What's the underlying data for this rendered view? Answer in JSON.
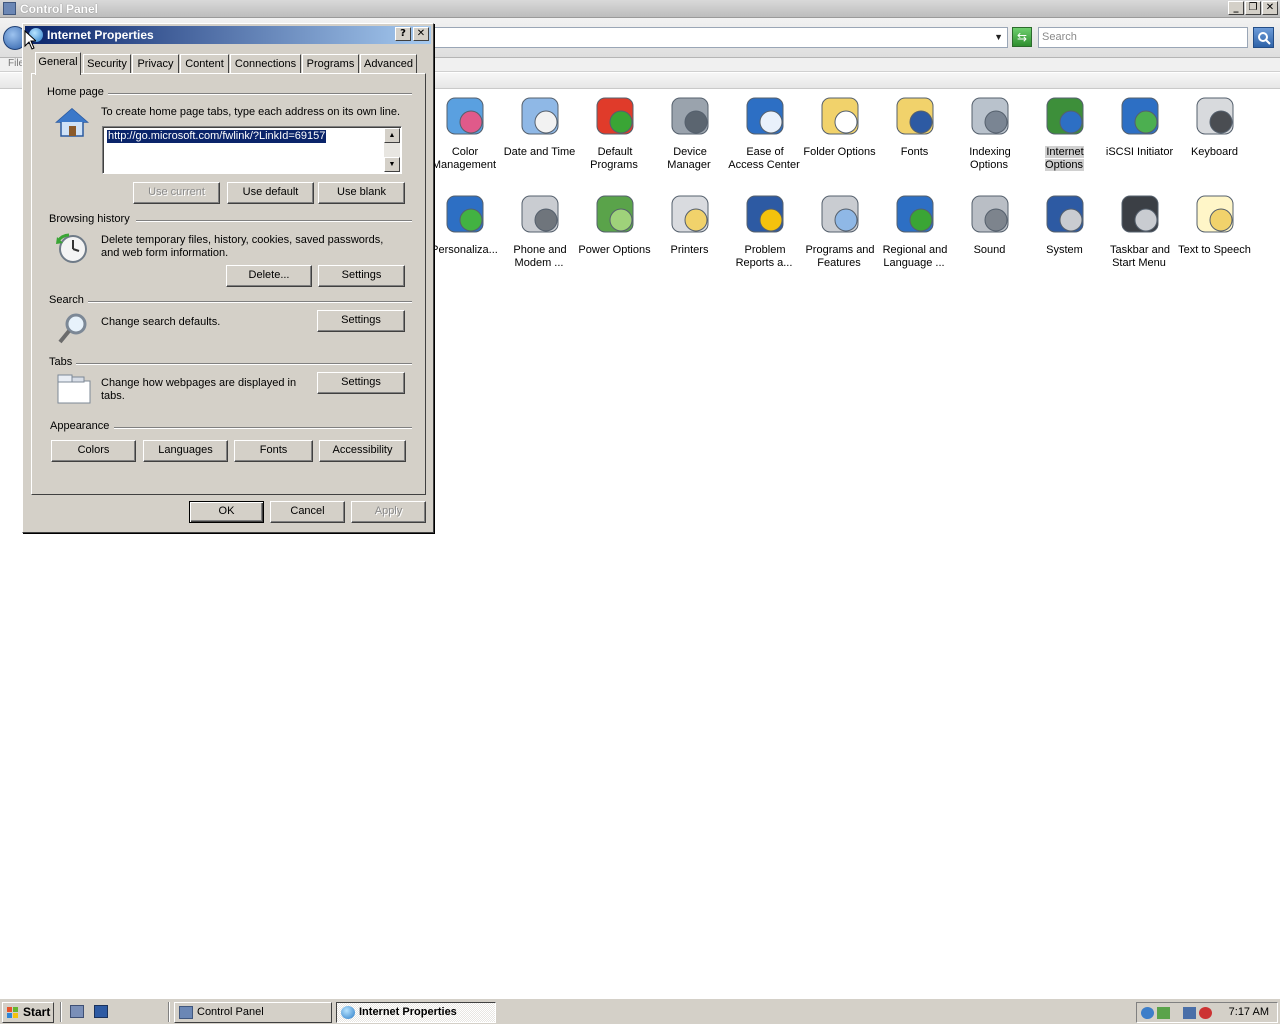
{
  "main_window": {
    "title": "Control Panel",
    "search_placeholder": "Search",
    "menu_partial": "File",
    "controls": {
      "minimize": "_",
      "maximize": "❐",
      "close": "✕"
    }
  },
  "control_panel_items": [
    {
      "label": "Color Management",
      "icon": "color-management-icon"
    },
    {
      "label": "Date and Time",
      "icon": "date-time-icon"
    },
    {
      "label": "Default Programs",
      "icon": "default-programs-icon"
    },
    {
      "label": "Device Manager",
      "icon": "device-manager-icon"
    },
    {
      "label": "Ease of Access Center",
      "icon": "ease-of-access-icon"
    },
    {
      "label": "Folder Options",
      "icon": "folder-options-icon"
    },
    {
      "label": "Fonts",
      "icon": "fonts-icon"
    },
    {
      "label": "Indexing Options",
      "icon": "indexing-options-icon"
    },
    {
      "label": "Internet Options",
      "icon": "internet-options-icon",
      "selected": true
    },
    {
      "label": "iSCSI Initiator",
      "icon": "iscsi-initiator-icon"
    },
    {
      "label": "Keyboard",
      "icon": "keyboard-icon"
    },
    {
      "label": "Personaliza...",
      "icon": "personalization-icon"
    },
    {
      "label": "Phone and Modem ...",
      "icon": "phone-modem-icon"
    },
    {
      "label": "Power Options",
      "icon": "power-options-icon"
    },
    {
      "label": "Printers",
      "icon": "printers-icon"
    },
    {
      "label": "Problem Reports a...",
      "icon": "problem-reports-icon"
    },
    {
      "label": "Programs and Features",
      "icon": "programs-features-icon"
    },
    {
      "label": "Regional and Language ...",
      "icon": "regional-language-icon"
    },
    {
      "label": "Sound",
      "icon": "sound-icon"
    },
    {
      "label": "System",
      "icon": "system-icon"
    },
    {
      "label": "Taskbar and Start Menu",
      "icon": "taskbar-start-menu-icon"
    },
    {
      "label": "Text to Speech",
      "icon": "text-to-speech-icon"
    }
  ],
  "dialog": {
    "title": "Internet Properties",
    "help_button": "?",
    "close_button": "✕",
    "tabs": [
      "General",
      "Security",
      "Privacy",
      "Content",
      "Connections",
      "Programs",
      "Advanced"
    ],
    "active_tab": "General",
    "home_page": {
      "group_label": "Home page",
      "instruction": "To create home page tabs, type each address on its own line.",
      "url": "http://go.microsoft.com/fwlink/?LinkId=69157",
      "buttons": {
        "use_current": "Use current",
        "use_default": "Use default",
        "use_blank": "Use blank"
      }
    },
    "browsing_history": {
      "group_label": "Browsing history",
      "description": "Delete temporary files, history, cookies, saved passwords, and web form information.",
      "buttons": {
        "delete": "Delete...",
        "settings": "Settings"
      }
    },
    "search": {
      "group_label": "Search",
      "description": "Change search defaults.",
      "settings": "Settings"
    },
    "tabs_section": {
      "group_label": "Tabs",
      "description": "Change how webpages are displayed in tabs.",
      "settings": "Settings"
    },
    "appearance": {
      "group_label": "Appearance",
      "buttons": {
        "colors": "Colors",
        "languages": "Languages",
        "fonts": "Fonts",
        "accessibility": "Accessibility"
      }
    },
    "footer": {
      "ok": "OK",
      "cancel": "Cancel",
      "apply": "Apply"
    }
  },
  "taskbar": {
    "start": "Start",
    "buttons": [
      "Control Panel",
      "Internet Properties"
    ],
    "active_button": "Internet Properties",
    "clock": "7:17 AM"
  },
  "colors": {
    "dialog_face": "#d4d0c8",
    "title_active_start": "#0a246a",
    "title_active_end": "#a6caf0",
    "selection": "#0a246a"
  }
}
